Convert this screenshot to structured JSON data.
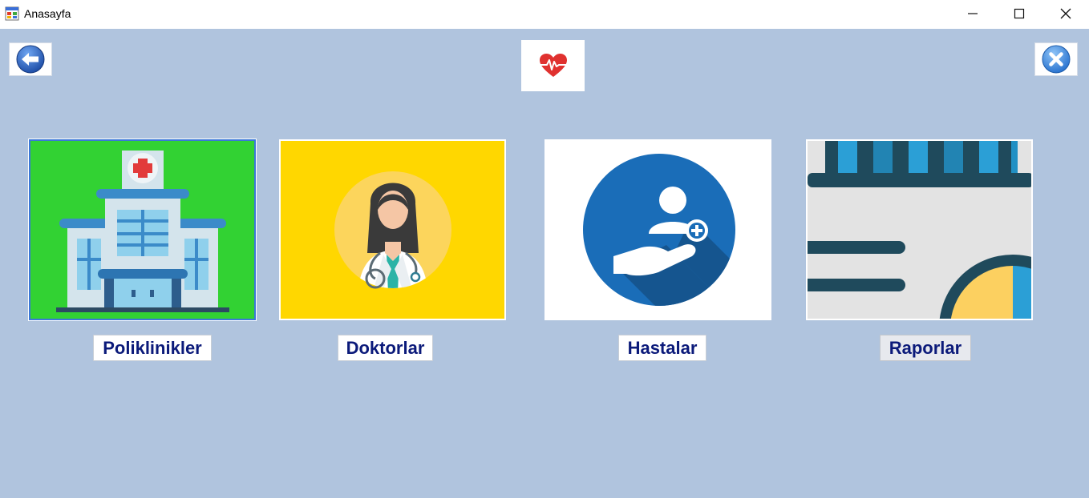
{
  "window": {
    "title": "Anasayfa",
    "app_icon": "winforms-app-icon",
    "controls": [
      "minimize-icon",
      "maximize-icon",
      "close-icon"
    ]
  },
  "toolbar": {
    "back_icon": "back-arrow-icon",
    "logo_icon": "heart-pulse-icon",
    "exit_icon": "close-circle-icon"
  },
  "modules": [
    {
      "label": "Poliklinikler",
      "icon": "hospital-icon",
      "background": "#32d233",
      "selected": true
    },
    {
      "label": "Doktorlar",
      "icon": "doctor-icon",
      "background": "#ffd700"
    },
    {
      "label": "Hastalar",
      "icon": "patient-care-icon",
      "background": "#ffffff"
    },
    {
      "label": "Raporlar",
      "icon": "report-chart-icon",
      "background": "#e3e3e3"
    }
  ],
  "colors": {
    "client_background": "#b0c4de",
    "label_text": "#0b1a7a"
  }
}
